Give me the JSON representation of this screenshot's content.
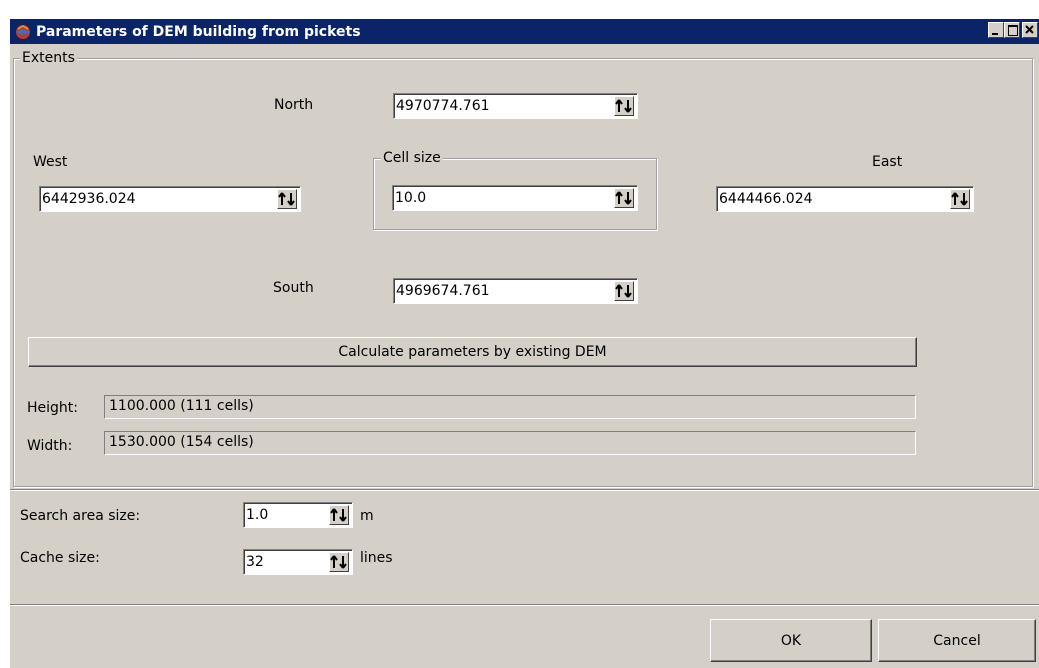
{
  "window": {
    "title": "Parameters of DEM building from pickets"
  },
  "extents": {
    "legend": "Extents",
    "north": {
      "label": "North",
      "value": "4970774.761"
    },
    "west": {
      "label": "West",
      "value": "6442936.024"
    },
    "east": {
      "label": "East",
      "value": "6444466.024"
    },
    "south": {
      "label": "South",
      "value": "4969674.761"
    },
    "cell_size": {
      "legend": "Cell size",
      "value": "10.0"
    },
    "calculate_button": "Calculate parameters by existing DEM",
    "height": {
      "label": "Height:",
      "value": "1100.000 (111 cells)"
    },
    "width": {
      "label": "Width:",
      "value": "1530.000 (154 cells)"
    }
  },
  "options": {
    "search_area": {
      "label": "Search area size:",
      "value": "1.0",
      "unit": "m"
    },
    "cache": {
      "label": "Cache size:",
      "value": "32",
      "unit": "lines"
    }
  },
  "footer": {
    "ok": "OK",
    "cancel": "Cancel"
  },
  "icons": {
    "app": "dem-globe-icon",
    "spin": "spin-arrows-icon"
  },
  "colors": {
    "titlebar": "#0a246a",
    "window": "#d4d0c8"
  }
}
